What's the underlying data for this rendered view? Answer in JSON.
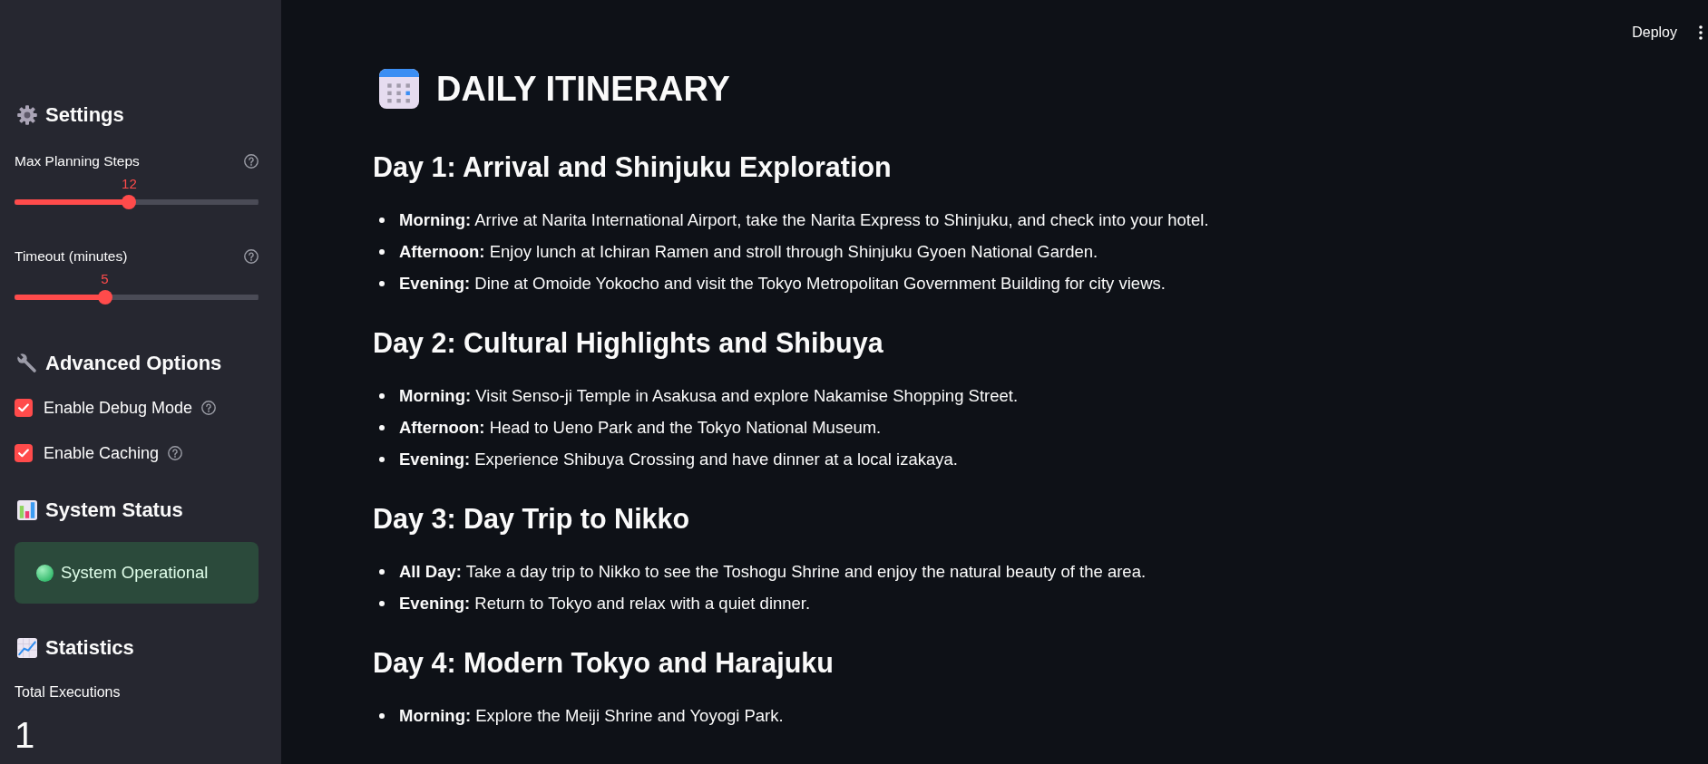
{
  "header": {
    "deploy_button": "Deploy"
  },
  "sidebar": {
    "settings": {
      "title": "Settings",
      "sliders": [
        {
          "label": "Max Planning Steps",
          "reading": "12",
          "level": 0.47
        },
        {
          "label": "Timeout (minutes)",
          "reading": "5",
          "level": 0.37
        }
      ]
    },
    "advanced_options": {
      "title": "Advanced Options",
      "checkboxes": [
        {
          "label": "Enable Debug Mode",
          "checked": true
        },
        {
          "label": "Enable Caching",
          "checked": true
        }
      ]
    },
    "system_status": {
      "title": "System Status",
      "kind": "success",
      "message": "System Operational"
    },
    "statistics": {
      "title": "Statistics",
      "metrics": [
        {
          "label": "Total Executions",
          "value": "1"
        }
      ]
    }
  },
  "main": {
    "title": "DAILY ITINERARY",
    "days": [
      {
        "heading": "Day 1: Arrival and Shinjuku Exploration",
        "items": [
          "**Morning:** Arrive at Narita International Airport, take the Narita Express to Shinjuku, and check into your hotel.",
          "**Afternoon:** Enjoy lunch at Ichiran Ramen and stroll through Shinjuku Gyoen National Garden.",
          "**Evening:** Dine at Omoide Yokocho and visit the Tokyo Metropolitan Government Building for city views."
        ]
      },
      {
        "heading": "Day 2: Cultural Highlights and Shibuya",
        "items": [
          "**Morning:** Visit Senso-ji Temple in Asakusa and explore Nakamise Shopping Street.",
          "**Afternoon:** Head to Ueno Park and the Tokyo National Museum.",
          "**Evening:** Experience Shibuya Crossing and have dinner at a local izakaya."
        ]
      },
      {
        "heading": "Day 3: Day Trip to Nikko",
        "items": [
          "**All Day:** Take a day trip to Nikko to see the Toshogu Shrine and enjoy the natural beauty of the area.",
          "**Evening:** Return to Tokyo and relax with a quiet dinner."
        ]
      },
      {
        "heading": "Day 4: Modern Tokyo and Harajuku",
        "items": [
          "**Morning:** Explore the Meiji Shrine and Yoyogi Park."
        ]
      }
    ]
  }
}
